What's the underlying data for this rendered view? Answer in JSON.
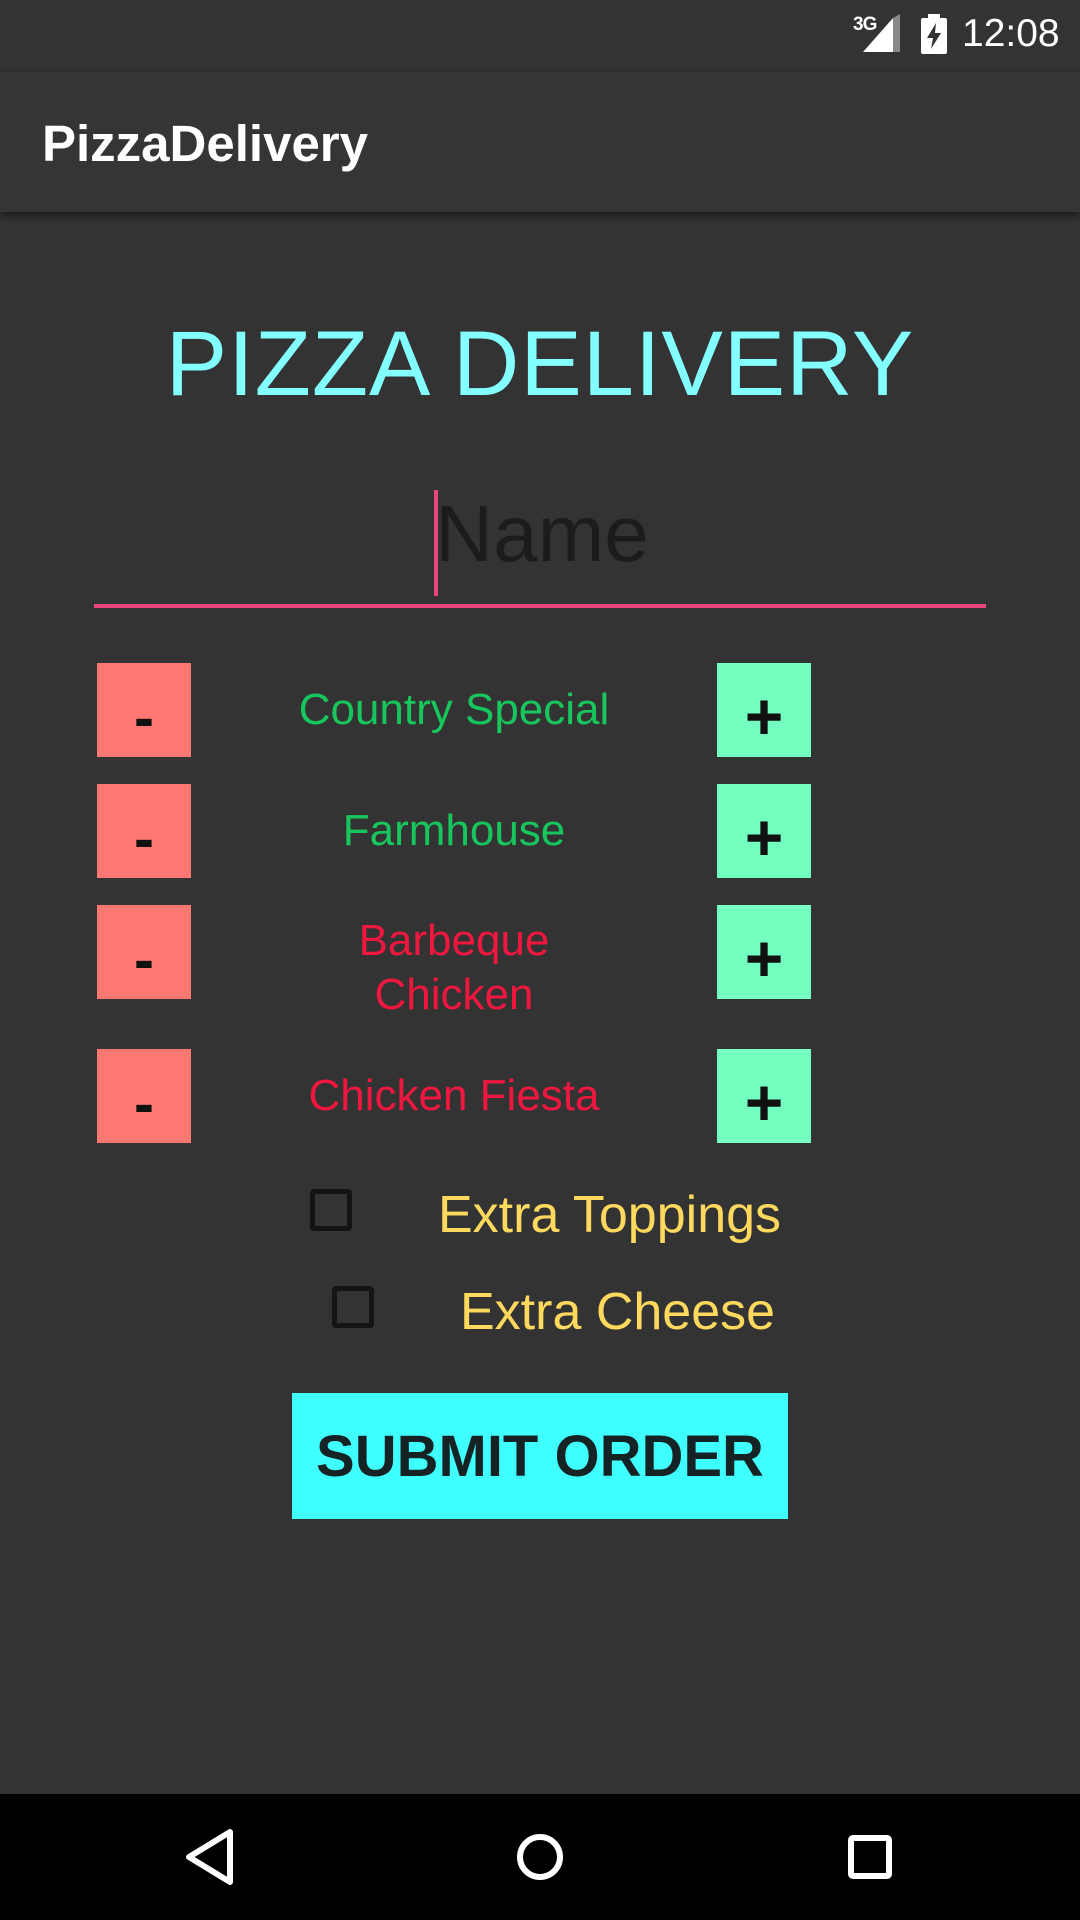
{
  "status_bar": {
    "network": "3G",
    "time": "12:08",
    "icons": [
      "cellular-signal-icon",
      "battery-charging-icon"
    ]
  },
  "app_bar": {
    "title": "PizzaDelivery"
  },
  "heading": "PIZZA DELIVERY",
  "name_input": {
    "placeholder": "Name",
    "value": "",
    "accent": "#e9457b"
  },
  "pizzas": [
    {
      "name": "Country Special",
      "color": "#17c65c",
      "minus": "-",
      "plus": "+"
    },
    {
      "name": "Farmhouse",
      "color": "#17c65c",
      "minus": "-",
      "plus": "+"
    },
    {
      "name": "Barbeque Chicken",
      "color": "#f0173f",
      "minus": "-",
      "plus": "+"
    },
    {
      "name": "Chicken Fiesta",
      "color": "#f0173f",
      "minus": "-",
      "plus": "+"
    }
  ],
  "extras": [
    {
      "label": "Extra Toppings",
      "checked": false
    },
    {
      "label": "Extra Cheese",
      "checked": false
    }
  ],
  "submit_label": "SUBMIT ORDER",
  "nav": {
    "icons": [
      "back-icon",
      "home-icon",
      "recents-icon"
    ]
  },
  "colors": {
    "background": "#333333",
    "heading": "#84ffff",
    "minus_button": "#fe7873",
    "plus_button": "#72ffbf",
    "extras_text": "#ffd95e",
    "submit_button": "#40ffff"
  }
}
